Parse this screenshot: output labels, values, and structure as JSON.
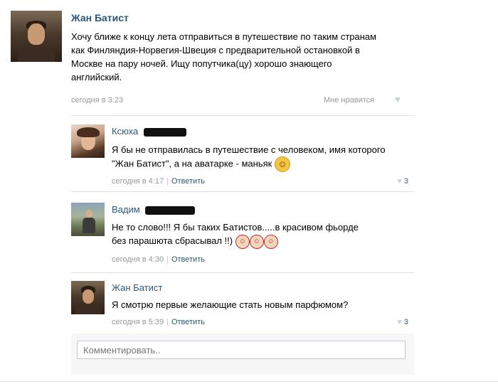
{
  "post": {
    "author": "Жан Батист",
    "text": "Хочу ближе к концу лета отправиться в путешествие по таким странам как Финляндия-Норвегия-Швеция с предварительной остановкой в Москве на пару ночей. Ищу попутчика(цу) хорошо знающего английский.",
    "time": "сегодня в 3:23",
    "like_label": "Мне нравится",
    "like_icon": "heart-icon"
  },
  "comments": [
    {
      "name": "Ксюха",
      "text": "Я бы не отправилась в путешествие с человеком, имя которого \"Жан Батист\", а на аватарке - маньяк",
      "time": "сегодня в 4:17",
      "reply": "Ответить",
      "likes": "3",
      "emoji": "grinning-emoji"
    },
    {
      "name": "Вадим",
      "text": "Не то слово!!! Я бы таких Батистов.....в красивом фьорде без парашюта сбрасывал !!)",
      "time": "сегодня в 4:30",
      "reply": "Ответить",
      "likes": "",
      "emoji": "santa-emoji"
    },
    {
      "name": "Жан Батист",
      "text": "Я смотрю первые желающие стать новым парфюмом?",
      "time": "сегодня в 5:39",
      "reply": "Ответить",
      "likes": "3"
    }
  ],
  "comment_input": {
    "placeholder": "Комментировать.."
  },
  "colors": {
    "link": "#2b587a",
    "meta": "#999999",
    "divider": "#dae1e8"
  }
}
